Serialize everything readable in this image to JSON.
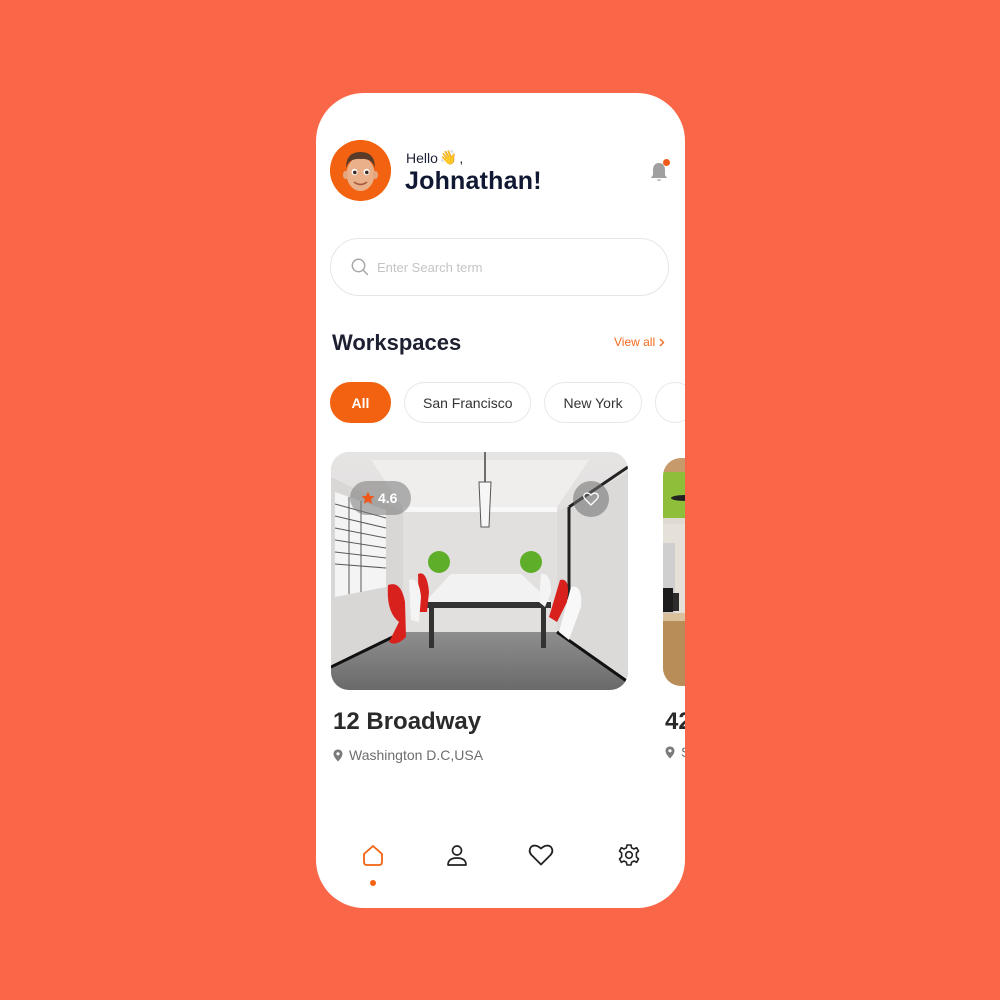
{
  "header": {
    "greeting": "Hello",
    "greeting_emoji": "👋",
    "greeting_suffix": ",",
    "user_name": "Johnathan!",
    "has_notification": true
  },
  "search": {
    "placeholder": "Enter Search term",
    "value": ""
  },
  "workspaces": {
    "title": "Workspaces",
    "view_all_label": "View all",
    "view_all_icon": "chevron-right-icon",
    "filters": [
      {
        "label": "All",
        "active": true
      },
      {
        "label": "San Francisco",
        "active": false
      },
      {
        "label": "New York",
        "active": false
      }
    ],
    "cards": [
      {
        "title": "12 Broadway",
        "location": "Washington D.C,USA",
        "rating": "4.6",
        "rating_icon": "star-icon",
        "favorite_icon": "heart-outline-icon",
        "image": "conference room with white table and red/white chairs"
      },
      {
        "title": "42",
        "location": "S",
        "image": "office with green wall"
      }
    ]
  },
  "bottom_nav": {
    "items": [
      {
        "icon": "home-icon",
        "active": true
      },
      {
        "icon": "user-icon",
        "active": false
      },
      {
        "icon": "heart-icon",
        "active": false
      },
      {
        "icon": "settings-icon",
        "active": false
      }
    ]
  },
  "colors": {
    "background": "#FA6648",
    "accent": "#F26211",
    "text_dark": "#111833",
    "text_muted": "#6E6E6E"
  }
}
